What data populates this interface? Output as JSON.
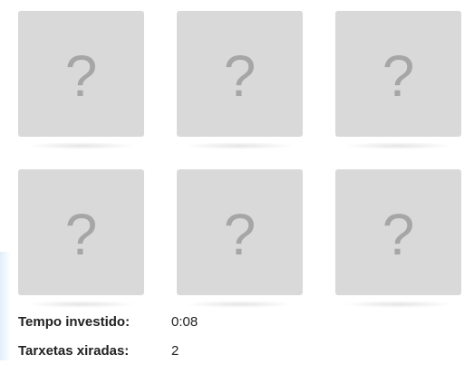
{
  "board": {
    "cards": [
      {
        "symbol": "?"
      },
      {
        "symbol": "?"
      },
      {
        "symbol": "?"
      },
      {
        "symbol": "?"
      },
      {
        "symbol": "?"
      },
      {
        "symbol": "?"
      }
    ]
  },
  "stats": {
    "time_label": "Tempo investido:",
    "time_value": "0:08",
    "flips_label": "Tarxetas xiradas:",
    "flips_value": "2"
  },
  "colors": {
    "card_back": "#d9d9d9",
    "card_symbol": "#a6a6a6",
    "text": "#222222"
  }
}
